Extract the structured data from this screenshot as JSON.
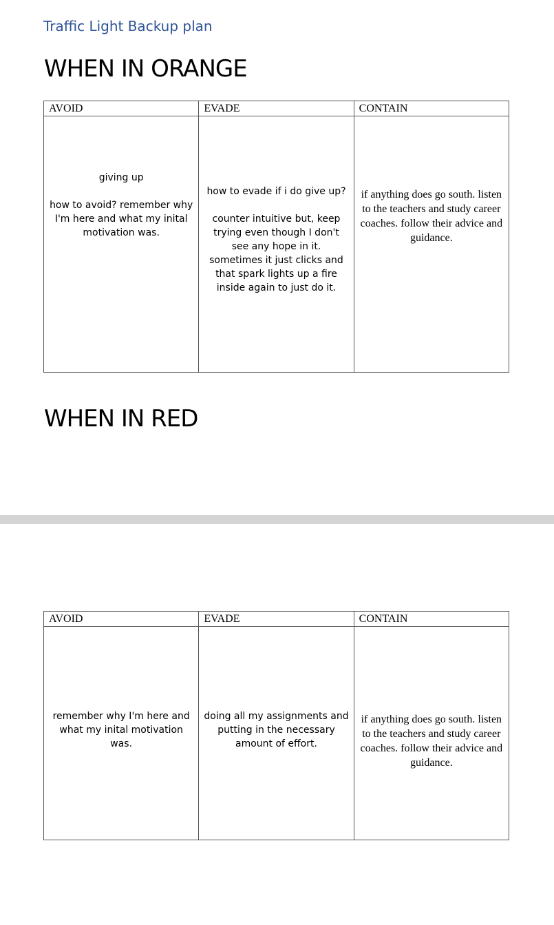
{
  "document": {
    "title": "Traffic Light Backup plan",
    "headers": [
      "AVOID",
      "EVADE",
      "CONTAIN"
    ]
  },
  "orange": {
    "heading": "WHEN IN ORANGE",
    "avoid": {
      "line1": "giving up",
      "line2": "how to avoid? remember why I'm here and what my inital motivation was."
    },
    "evade": {
      "line1": "how to evade if i do give up?",
      "line2": "counter intuitive but, keep trying even though I don't see any hope in it. sometimes it just clicks and that spark lights up a fire inside again to just do it."
    },
    "contain": "if anything does go south. listen to the teachers and study career coaches. follow their advice and guidance."
  },
  "red": {
    "heading": "WHEN IN RED",
    "avoid": "remember why I'm here and what my inital motivation was.",
    "evade": "doing all my assignments and putting in the necessary amount of effort.",
    "contain": "if anything does go south. listen to the teachers and study career coaches. follow their advice and guidance."
  }
}
